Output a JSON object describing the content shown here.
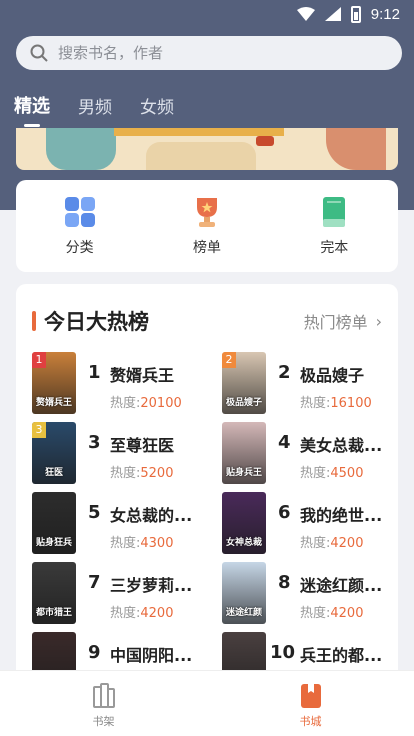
{
  "status_bar": {
    "time": "9:12"
  },
  "search": {
    "placeholder": "搜索书名，作者"
  },
  "tabs": [
    {
      "label": "精选",
      "active": true
    },
    {
      "label": "男频",
      "active": false
    },
    {
      "label": "女频",
      "active": false
    }
  ],
  "categories": [
    {
      "label": "分类",
      "icon": "grid-icon"
    },
    {
      "label": "榜单",
      "icon": "trophy-icon"
    },
    {
      "label": "完本",
      "icon": "book-icon"
    }
  ],
  "ranking": {
    "title": "今日大热榜",
    "more": "热门榜单",
    "heat_label": "热度:",
    "books": [
      {
        "rank": "1",
        "name": "赘婿兵王",
        "heat": "20100",
        "badge": "1",
        "cover_text": "赘婿兵王",
        "cover_color": "#c9803a"
      },
      {
        "rank": "2",
        "name": "极品嫂子",
        "heat": "16100",
        "badge": "2",
        "cover_text": "极品嫂子",
        "cover_color": "#d8c6b2"
      },
      {
        "rank": "3",
        "name": "至尊狂医",
        "heat": "5200",
        "badge": "3",
        "cover_text": "狂医",
        "cover_color": "#2a4a6a"
      },
      {
        "rank": "4",
        "name": "美女总裁...",
        "heat": "4500",
        "badge": "",
        "cover_text": "贴身兵王",
        "cover_color": "#d4b8b8"
      },
      {
        "rank": "5",
        "name": "女总裁的...",
        "heat": "4300",
        "badge": "",
        "cover_text": "贴身狂兵",
        "cover_color": "#2d2d2d"
      },
      {
        "rank": "6",
        "name": "我的绝世...",
        "heat": "4200",
        "badge": "",
        "cover_text": "女神总裁",
        "cover_color": "#4a2a5a"
      },
      {
        "rank": "7",
        "name": "三岁萝莉...",
        "heat": "4200",
        "badge": "",
        "cover_text": "都市猎王",
        "cover_color": "#3a3a3a"
      },
      {
        "rank": "8",
        "name": "迷途红颜...",
        "heat": "4200",
        "badge": "",
        "cover_text": "迷途红颜",
        "cover_color": "#c6d6e6"
      },
      {
        "rank": "9",
        "name": "中国阴阳...",
        "heat": "",
        "badge": "",
        "cover_text": "",
        "cover_color": "#3a2a2a"
      },
      {
        "rank": "10",
        "name": "兵王的都...",
        "heat": "",
        "badge": "",
        "cover_text": "",
        "cover_color": "#4a4040"
      }
    ]
  },
  "bottom_nav": [
    {
      "label": "书架",
      "icon": "bookshelf-icon",
      "active": false
    },
    {
      "label": "书城",
      "icon": "bookstore-icon",
      "active": true
    }
  ],
  "colors": {
    "accent": "#e86a3c",
    "header_bg": "#55607c"
  }
}
